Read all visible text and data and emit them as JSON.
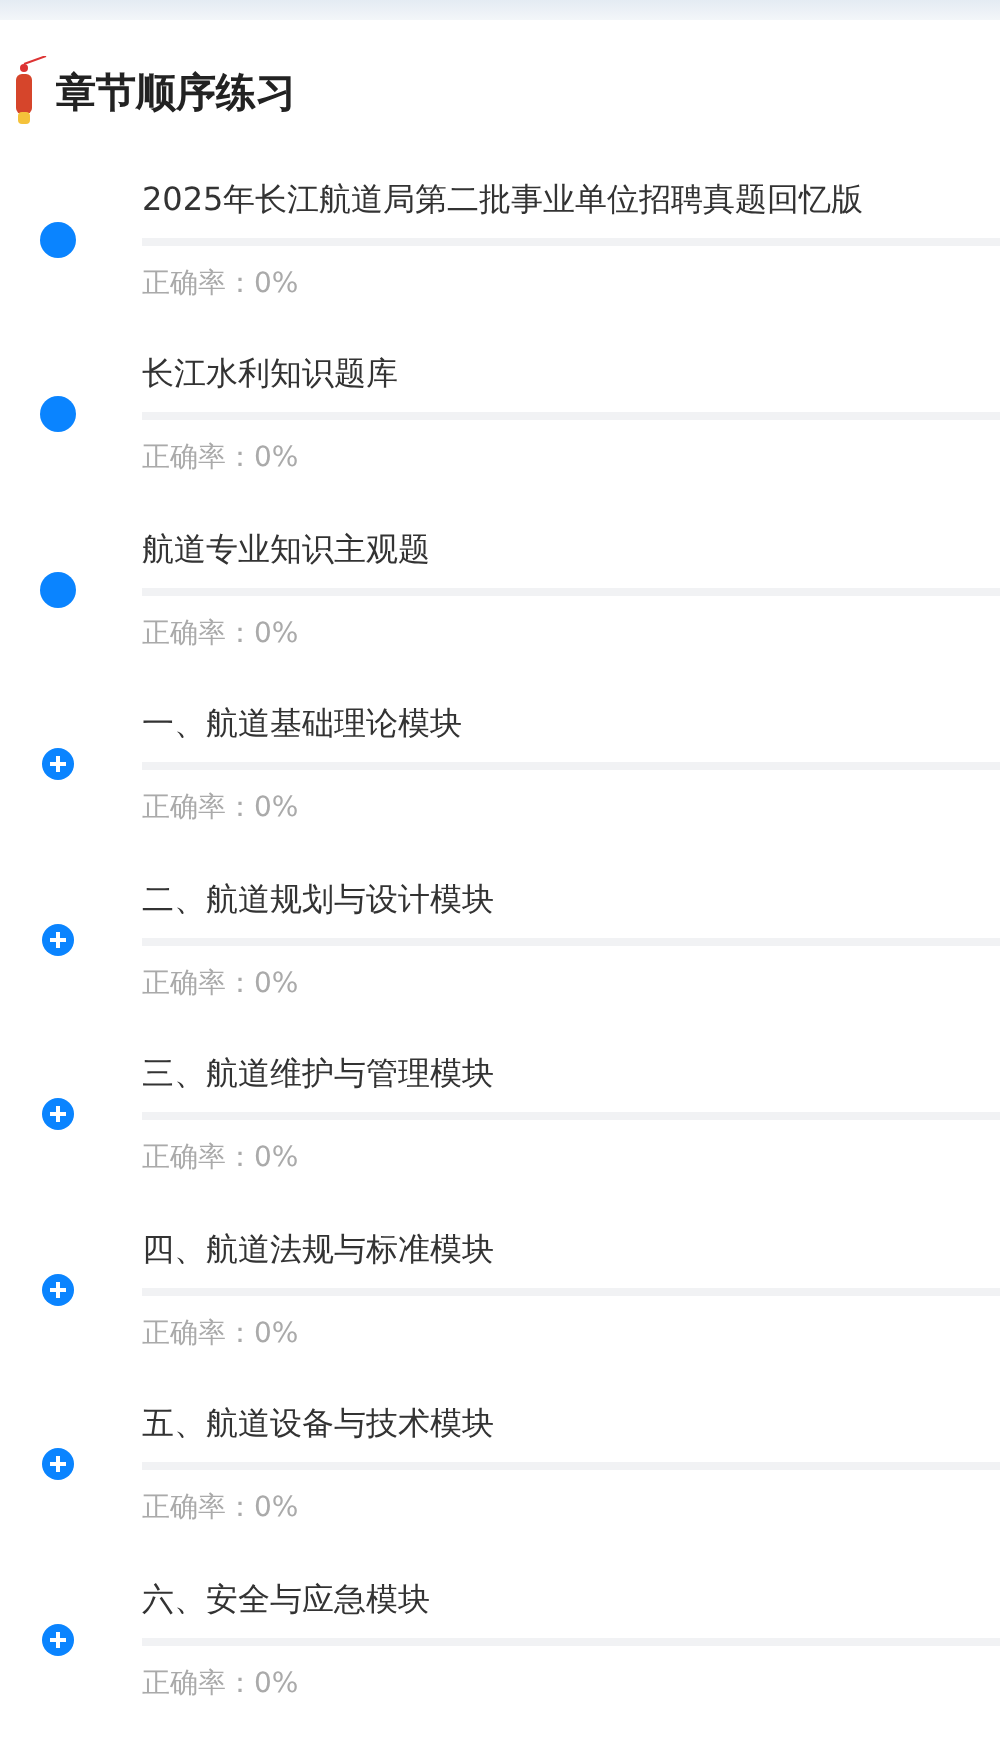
{
  "title": "章节顺序练习",
  "chapters": [
    {
      "kind": "leaf",
      "name": "2025年长江航道局第二批事业单位招聘真题回忆版",
      "level": 0,
      "accuracy": "正确率：0%"
    },
    {
      "kind": "leaf",
      "name": "长江水利知识题库",
      "level": 0,
      "accuracy": "正确率：0%"
    },
    {
      "kind": "leaf",
      "name": "航道专业知识主观题",
      "level": 0,
      "accuracy": "正确率：0%"
    },
    {
      "kind": "group",
      "name": "一、航道基础理论模块",
      "level": 0,
      "accuracy": "正确率：0%"
    },
    {
      "kind": "group",
      "name": "二、航道规划与设计模块",
      "level": 0,
      "accuracy": "正确率：0%"
    },
    {
      "kind": "group",
      "name": "三、航道维护与管理模块",
      "level": 0,
      "accuracy": "正确率：0%"
    },
    {
      "kind": "group",
      "name": "四、航道法规与标准模块",
      "level": 0,
      "accuracy": "正确率：0%"
    },
    {
      "kind": "group",
      "name": "五、航道设备与技术模块",
      "level": 0,
      "accuracy": "正确率：0%"
    },
    {
      "kind": "group",
      "name": "六、安全与应急模块",
      "level": 0,
      "accuracy": "正确率：0%"
    }
  ]
}
